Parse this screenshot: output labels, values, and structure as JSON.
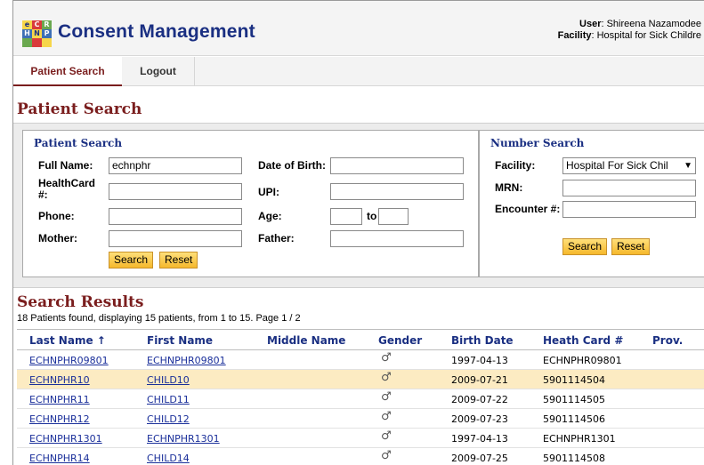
{
  "header": {
    "logo_letters": [
      "e",
      "C",
      "H",
      "R",
      "N",
      "P"
    ],
    "app_title": "Consent Management",
    "user_label": "User",
    "user_value": ": Shireena Nazamodee",
    "facility_label": "Facility",
    "facility_value": ": Hospital for Sick Childre"
  },
  "nav": {
    "tabs": [
      {
        "label": "Patient Search"
      },
      {
        "label": "Logout"
      }
    ]
  },
  "page_title": "Patient Search",
  "patient_search": {
    "title": "Patient Search",
    "full_name_label": "Full Name:",
    "full_name_value": "echnphr",
    "healthcard_label": "HealthCard #:",
    "phone_label": "Phone:",
    "mother_label": "Mother:",
    "dob_label": "Date of Birth:",
    "upi_label": "UPI:",
    "age_label": "Age:",
    "age_to": "to",
    "father_label": "Father:",
    "search_button": "Search",
    "reset_button": "Reset"
  },
  "number_search": {
    "title": "Number Search",
    "facility_label": "Facility:",
    "facility_selected": "Hospital For Sick Chil",
    "mrn_label": "MRN:",
    "encounter_label": "Encounter #:",
    "search_button": "Search",
    "reset_button": "Reset"
  },
  "results": {
    "title": "Search Results",
    "summary": "18 Patients found, displaying 15 patients, from 1 to 15. Page 1 / 2",
    "columns": [
      "Last Name ↑",
      "First Name",
      "Middle Name",
      "Gender",
      "Birth Date",
      "Heath Card #",
      "Prov."
    ],
    "gender_symbol": "♂",
    "rows": [
      {
        "last": "ECHNPHR09801",
        "first": "ECHNPHR09801",
        "middle": "",
        "birth": "1997-04-13",
        "card": "ECHNPHR09801",
        "prov": ""
      },
      {
        "last": "ECHNPHR10",
        "first": "CHILD10",
        "middle": "",
        "birth": "2009-07-21",
        "card": "5901114504",
        "prov": ""
      },
      {
        "last": "ECHNPHR11",
        "first": "CHILD11",
        "middle": "",
        "birth": "2009-07-22",
        "card": "5901114505",
        "prov": ""
      },
      {
        "last": "ECHNPHR12",
        "first": "CHILD12",
        "middle": "",
        "birth": "2009-07-23",
        "card": "5901114506",
        "prov": ""
      },
      {
        "last": "ECHNPHR1301",
        "first": "ECHNPHR1301",
        "middle": "",
        "birth": "1997-04-13",
        "card": "ECHNPHR1301",
        "prov": ""
      },
      {
        "last": "ECHNPHR14",
        "first": "CHILD14",
        "middle": "",
        "birth": "2009-07-25",
        "card": "5901114508",
        "prov": ""
      }
    ]
  },
  "colors": {
    "brand": "#1a2f82",
    "accent": "#7a1d1d",
    "row_alt": "#fcebc2",
    "button": "#f5b82c"
  }
}
